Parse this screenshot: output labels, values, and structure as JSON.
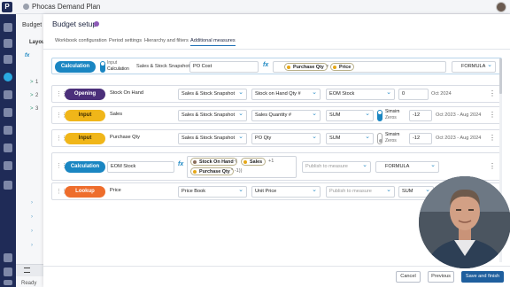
{
  "app": {
    "title": "Phocas Demand Plan",
    "logo": "P"
  },
  "rail": {
    "icons": [
      "home-icon",
      "grid-icon",
      "chart-icon",
      "budget-icon",
      "people-icon",
      "group-icon",
      "history-icon",
      "heart-icon",
      "cloud-icon",
      "admin-icon",
      "info-icon",
      "document-icon",
      "apps-icon"
    ]
  },
  "leftpanel": {
    "title": "Budget",
    "section": "Layout",
    "fx": "fx",
    "rows": [
      {
        "num": "1",
        "arrow": ">"
      },
      {
        "num": "2",
        "arrow": ">"
      },
      {
        "num": "3",
        "arrow": ">"
      }
    ],
    "status": "Ready"
  },
  "modal": {
    "title": "Budget setup",
    "tabs": [
      "Workbook configuration",
      "Period settings",
      "Hierarchy and filters",
      "Additional measures"
    ],
    "active_tab": 3,
    "rows": [
      {
        "type": "Calculation",
        "toggle_label_1": "Input",
        "toggle_label_2": "Calculation",
        "source": "Sales & Stock Snapshot",
        "name": "PO Cost",
        "formula_chips": [
          "Purchase Qty",
          "Price"
        ],
        "formula_op": "×",
        "mode": "FORMULA"
      },
      {
        "type": "Opening",
        "name": "Stock On Hand",
        "source": "Sales & Stock Snapshot",
        "measure": "Stock on Hand Qty #",
        "agg": "EOM Stock",
        "value": "0",
        "period": "Oct 2024"
      },
      {
        "type": "Input",
        "name": "Sales",
        "source": "Sales & Stock Snapshot",
        "measure": "Sales Quantity #",
        "agg": "SUM",
        "toggle_1": "Simsim",
        "toggle_2": "Zeros",
        "value": "-12",
        "period": "Oct 2023 - Aug 2024"
      },
      {
        "type": "Input",
        "name": "Purchase Qty",
        "source": "Sales & Stock Snapshot",
        "measure": "PO Qty",
        "agg": "SUM",
        "toggle_1": "Simsim",
        "toggle_2": "Zeros",
        "value": "-12",
        "period": "Oct 2023 - Aug 2024"
      },
      {
        "type": "Calculation",
        "name": "EOM Stock",
        "formula_chips": [
          "Stock On Hand",
          "Sales",
          "Purchase Qty"
        ],
        "formula_parts": [
          "-(",
          "+1",
          "* -1))"
        ],
        "publish": "Publish to measure",
        "mode": "FORMULA"
      },
      {
        "type": "Lookup",
        "name": "Price",
        "source": "Price Book",
        "measure": "Unit Price",
        "publish": "Publish to measure",
        "agg": "SUM"
      }
    ],
    "buttons": {
      "cancel": "Cancel",
      "previous": "Previous",
      "save": "Save and finish"
    }
  },
  "colors": {
    "accent": "#1a86c2",
    "opening": "#4b2f7a",
    "input": "#f0b619",
    "lookup": "#ee6d2c",
    "primary": "#1f5f9e",
    "rail": "#1f2b57"
  }
}
